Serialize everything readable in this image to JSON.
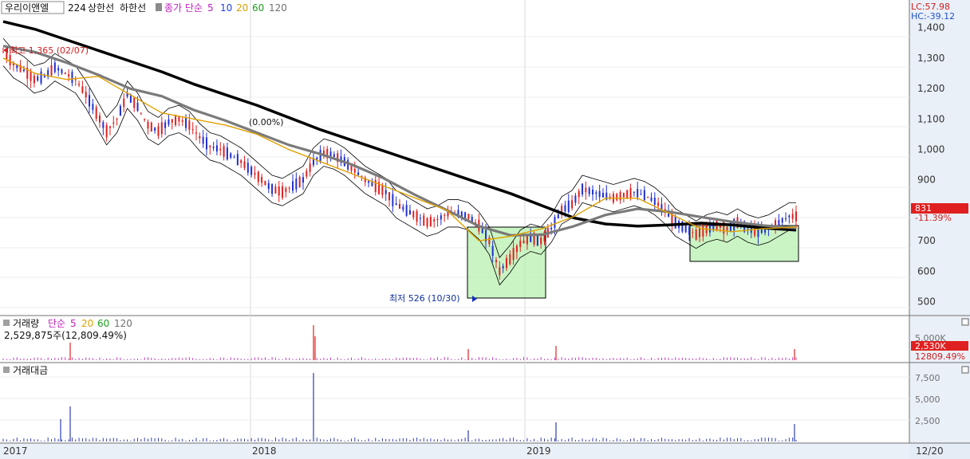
{
  "header": {
    "stock_name": "우리이앤엘",
    "stock_code": "224",
    "upper_limit_label": "상한선",
    "lower_limit_label": "하한선",
    "ma_label": "종가 단순",
    "ma_periods": [
      "5",
      "10",
      "20",
      "60",
      "120"
    ]
  },
  "right_readout": {
    "lc": "LC:57.98",
    "hc": "HC:-39.12"
  },
  "colors": {
    "ma5": "#d010d0",
    "ma10": "#2040e0",
    "ma20": "#e0a000",
    "ma60": "#20a020",
    "ma120": "#7a7a7a",
    "long_ma": "#000000",
    "candle_up": "#e02020",
    "candle_down": "#2030d0",
    "highlight": "#b8f0b0"
  },
  "chart_data": [
    {
      "type": "line",
      "panel": "price",
      "ylim": [
        470,
        1470
      ],
      "y_ticks": [
        "1,400",
        "1,300",
        "1,200",
        "1,100",
        "1,000",
        "900",
        "800",
        "700",
        "600",
        "500"
      ],
      "x_ticks": [
        "2017",
        "2018",
        "2019",
        "12/20"
      ],
      "annotations": {
        "high": "최고 1,365 (02/07)",
        "low": "최저 526 (10/30)",
        "mid_pct": "(0.00%)",
        "last_price": "831",
        "last_change": "-11.39%"
      },
      "series": [
        {
          "key": "ma120",
          "values": [
            1420,
            1395,
            1360,
            1325,
            1290,
            1255,
            1215,
            1180,
            1145,
            1105,
            1065,
            1030,
            995,
            960,
            925,
            890,
            855,
            815,
            775,
            755,
            748,
            752,
            758,
            752,
            742,
            735
          ]
        },
        {
          "key": "ma60",
          "values": [
            1340,
            1320,
            1285,
            1245,
            1200,
            1175,
            1130,
            1095,
            1055,
            1015,
            985,
            950,
            905,
            850,
            800,
            748,
            718,
            720,
            748,
            785,
            805,
            795,
            778,
            762,
            750,
            742
          ]
        },
        {
          "key": "ma20",
          "values": [
            1300,
            1250,
            1230,
            1240,
            1180,
            1120,
            1100,
            1080,
            1050,
            1000,
            960,
            920,
            880,
            840,
            800,
            700,
            715,
            740,
            780,
            840,
            840,
            790,
            740,
            730,
            740,
            745
          ]
        }
      ],
      "price": [
        1320,
        1280,
        1260,
        1230,
        1240,
        1270,
        1250,
        1230,
        1180,
        1120,
        1060,
        1100,
        1180,
        1140,
        1080,
        1060,
        1090,
        1100,
        1080,
        1040,
        1010,
        1000,
        980,
        960,
        930,
        900,
        870,
        860,
        880,
        900,
        960,
        990,
        980,
        960,
        930,
        900,
        880,
        860,
        820,
        800,
        780,
        760,
        770,
        790,
        790,
        780,
        750,
        700,
        600,
        640,
        690,
        710,
        700,
        740,
        800,
        820,
        870,
        860,
        850,
        840,
        850,
        860,
        850,
        830,
        800,
        760,
        740,
        720,
        740,
        750,
        740,
        760,
        740,
        730,
        740,
        760,
        780
      ]
    },
    {
      "type": "bar",
      "panel": "volume",
      "title": "거래량",
      "ma_label": "단순",
      "ma_periods": [
        "5",
        "20",
        "60",
        "120"
      ],
      "last_value": "2,529,875주(12,809.49%)",
      "y_ticks": [
        "5,000K"
      ],
      "right_badge": "2,530K",
      "right_badge_pct": "12809.49%"
    },
    {
      "type": "bar",
      "panel": "trading_value",
      "title": "거래대금",
      "y_ticks": [
        "7,500",
        "5,000",
        "2,500"
      ]
    }
  ]
}
